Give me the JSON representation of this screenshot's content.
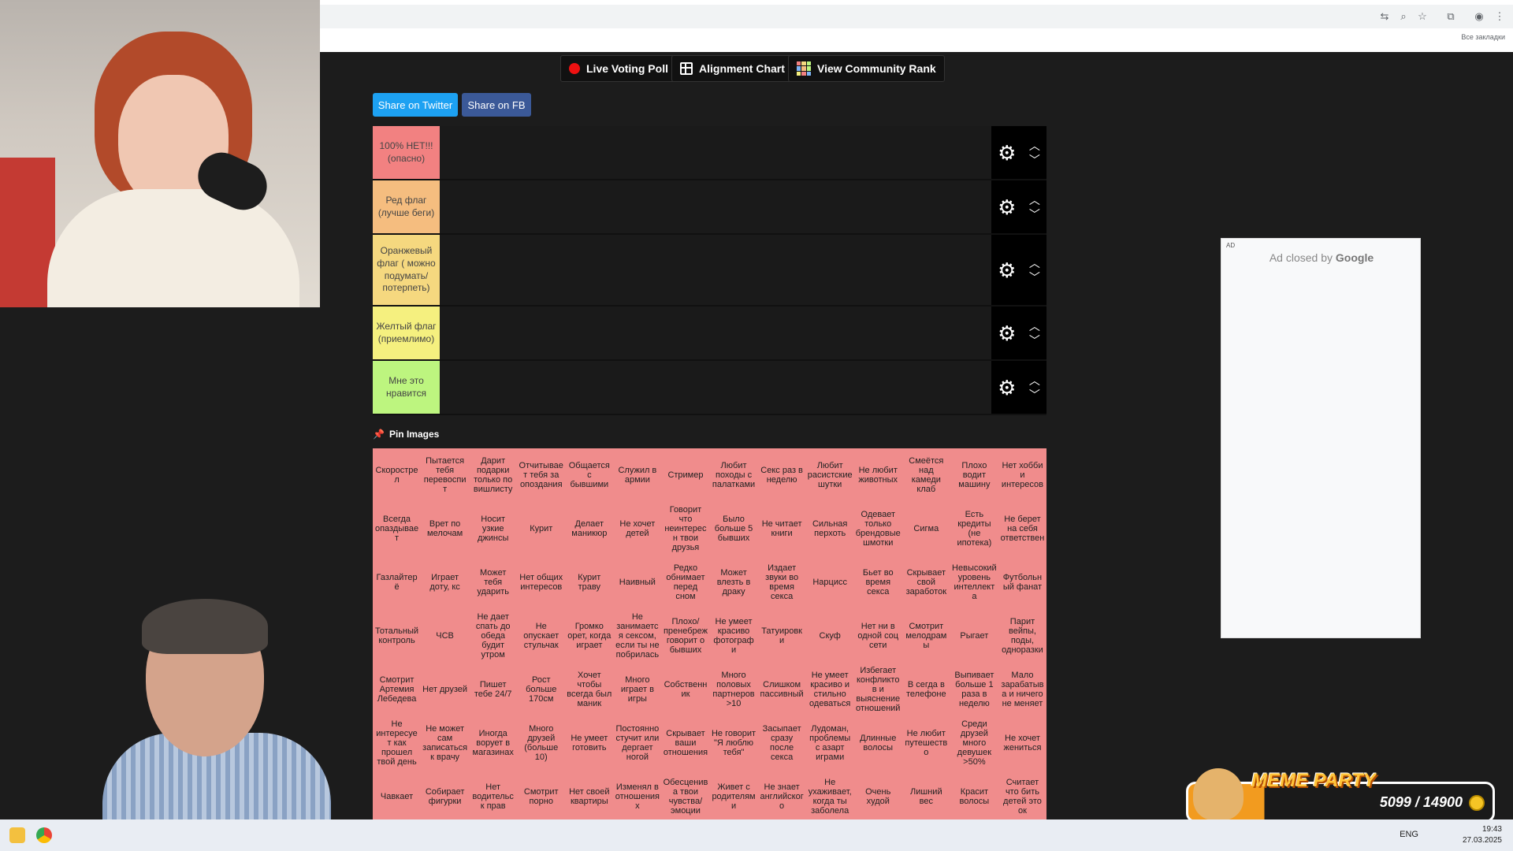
{
  "toolbar": {
    "live_poll": "Live Voting Poll",
    "alignment": "Alignment Chart",
    "community_rank": "View Community Rank"
  },
  "share": {
    "twitter": "Share on Twitter",
    "fb": "Share on FB"
  },
  "bookmarks_label": "Все закладки",
  "tiers": [
    {
      "label": "100% НЕТ!!! (опасно)",
      "color": "#f28181"
    },
    {
      "label": "Ред флаг (лучше беги)",
      "color": "#f5bd7f"
    },
    {
      "label": "Оранжевый флаг ( можно подумать/потерпеть)",
      "color": "#f5d87f"
    },
    {
      "label": "Желтый флаг (приемлимо)",
      "color": "#f5f07f"
    },
    {
      "label": "Мне это нравится",
      "color": "#bdf57f"
    }
  ],
  "pin_images": "Pin Images",
  "items": [
    "Скорострел",
    "Пытается тебя перевоспит",
    "Дарит подарки только по вишлисту",
    "Отчитывает тебя за опоздания",
    "Общается с бывшими",
    "Служил в армии",
    "Стример",
    "Любит походы с палатками",
    "Секс раз в неделю",
    "Любит расистские шутки",
    "Не любит животных",
    "Смеётся над камеди клаб",
    "Плохо водит машину",
    "Нет хобби и интересов",
    "Всегда опаздывает",
    "Врет по мелочам",
    "Носит узкие джинсы",
    "Курит",
    "Делает маникюр",
    "Не хочет детей",
    "Говорит что неинтересн твои друзья",
    "Было больше 5 бывших",
    "Не читает книги",
    "Сильная перхоть",
    "Одевает только брендовые шмотки",
    "Сигма",
    "Есть кредиты (не ипотека)",
    "Не берет на себя ответствен",
    "Газлайтерё",
    "Играет доту, кс",
    "Может тебя ударить",
    "Нет общих интересов",
    "Курит траву",
    "Наивный",
    "Редко обнимает перед сном",
    "Может влезть в драку",
    "Издает звуки во время секса",
    "Нарцисс",
    "Бьет во время секса",
    "Скрывает свой заработок",
    "Невысокий уровень интеллекта",
    "Футбольный фанат",
    "Тотальный контроль",
    "ЧСВ",
    "Не дает спать до обеда будит утром",
    "Не опускает стульчак",
    "Громко орет, когда играет",
    "Не занимается сексом, если ты не побрилась",
    "Плохо/ пренебреж говорит о бывших",
    "Не умеет красиво фотографи",
    "Татуировки",
    "Скуф",
    "Нет ни в одной соц сети",
    "Смотрит мелодрамы",
    "Рыгает",
    "Парит вейпы, поды, одноразки",
    "Смотрит Артемия Лебедева",
    "Нет друзей",
    "Пишет тебе 24/7",
    "Рост больше 170см",
    "Хочет чтобы всегда был маник",
    "Много играет в игры",
    "Собственник",
    "Много половых партнеров >10",
    "Слишком пассивный",
    "Не умеет красиво и стильно одеваться",
    "Избегает конфликтов и выяснение отношений",
    "В сегда в телефоне",
    "Выпивает больше 1 раза в неделю",
    "Мало зарабатыва и ничего не меняет",
    "Не интересует как прошел твой день",
    "Не может сам записаться к врачу",
    "Иногда ворует в магазинах",
    "Много друзей (больше 10)",
    "Не умеет готовить",
    "Постоянно стучит или дергает ногой",
    "Скрывает ваши отношения",
    "Не говорит \"Я люблю тебя\"",
    "Засыпает сразу после секса",
    "Лудоман, проблемы с азарт играми",
    "Длинные волосы",
    "Не любит путешество",
    "Среди друзей много девушек >50%",
    "Не хочет жениться",
    "Чавкает",
    "Собирает фигурки",
    "Нет водительск прав",
    "Смотрит порно",
    "Нет своей квартиры",
    "Изменял в отношениях",
    "Обесценива твои чувства/ эмоции",
    "Живет с родителями",
    "Не знает английского",
    "Не ухаживает, когда ты заболела",
    "Очень худой",
    "Лишний вес",
    "Красит волосы",
    "Считает что бить детей это ок"
  ],
  "ad": {
    "tag": "AD",
    "closed_text": "Ad closed by",
    "brand": "Google"
  },
  "meme_party": {
    "title": "MEME PARTY",
    "score": "5099 / 14900"
  },
  "taskbar": {
    "lang": "ENG",
    "time": "19:43",
    "date": "27.03.2025"
  }
}
